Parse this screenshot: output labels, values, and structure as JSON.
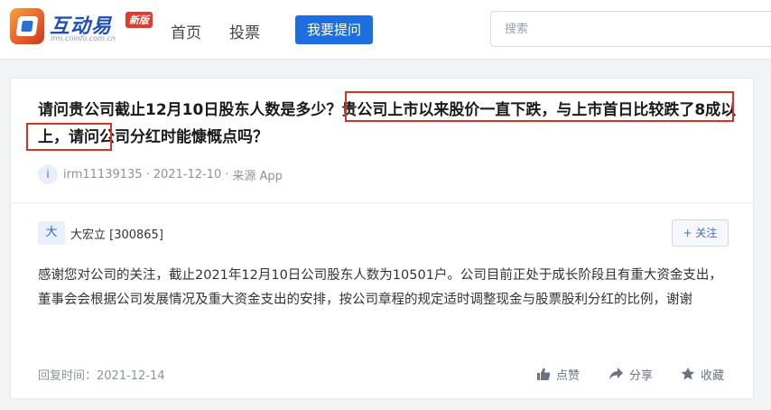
{
  "header": {
    "logo_title": "互动易",
    "logo_sub": "irm.cninfo.com.cn",
    "logo_badge": "新版",
    "nav_home": "首页",
    "nav_vote": "投票",
    "ask_button": "我要提问",
    "search_placeholder": "搜索"
  },
  "question": {
    "text": "请问贵公司截止12月10日股东人数是多少？贵公司上市以来股价一直下跌，与上市首日比较跌了8成以上，请问公司分红时能慷慨点吗？",
    "avatar_letter": "i",
    "user": "irm11139135",
    "date": "2021-12-10",
    "source": "来源 App"
  },
  "answer": {
    "avatar_char": "大",
    "company": "大宏立 [300865]",
    "follow_label": "+ 关注",
    "text": "感谢您对公司的关注，截止2021年12月10日公司股东人数为10501户。公司目前正处于成长阶段且有重大资金支出，董事会会根据公司发展情况及重大资金支出的安排，按公司章程的规定适时调整现金与股票股利分红的比例，谢谢",
    "reply_time": "回复时间：2021-12-14",
    "like_label": "点赞",
    "share_label": "分享",
    "fav_label": "收藏"
  },
  "colors": {
    "brand_blue": "#1d6fe0",
    "highlight_red": "#d9302a"
  }
}
